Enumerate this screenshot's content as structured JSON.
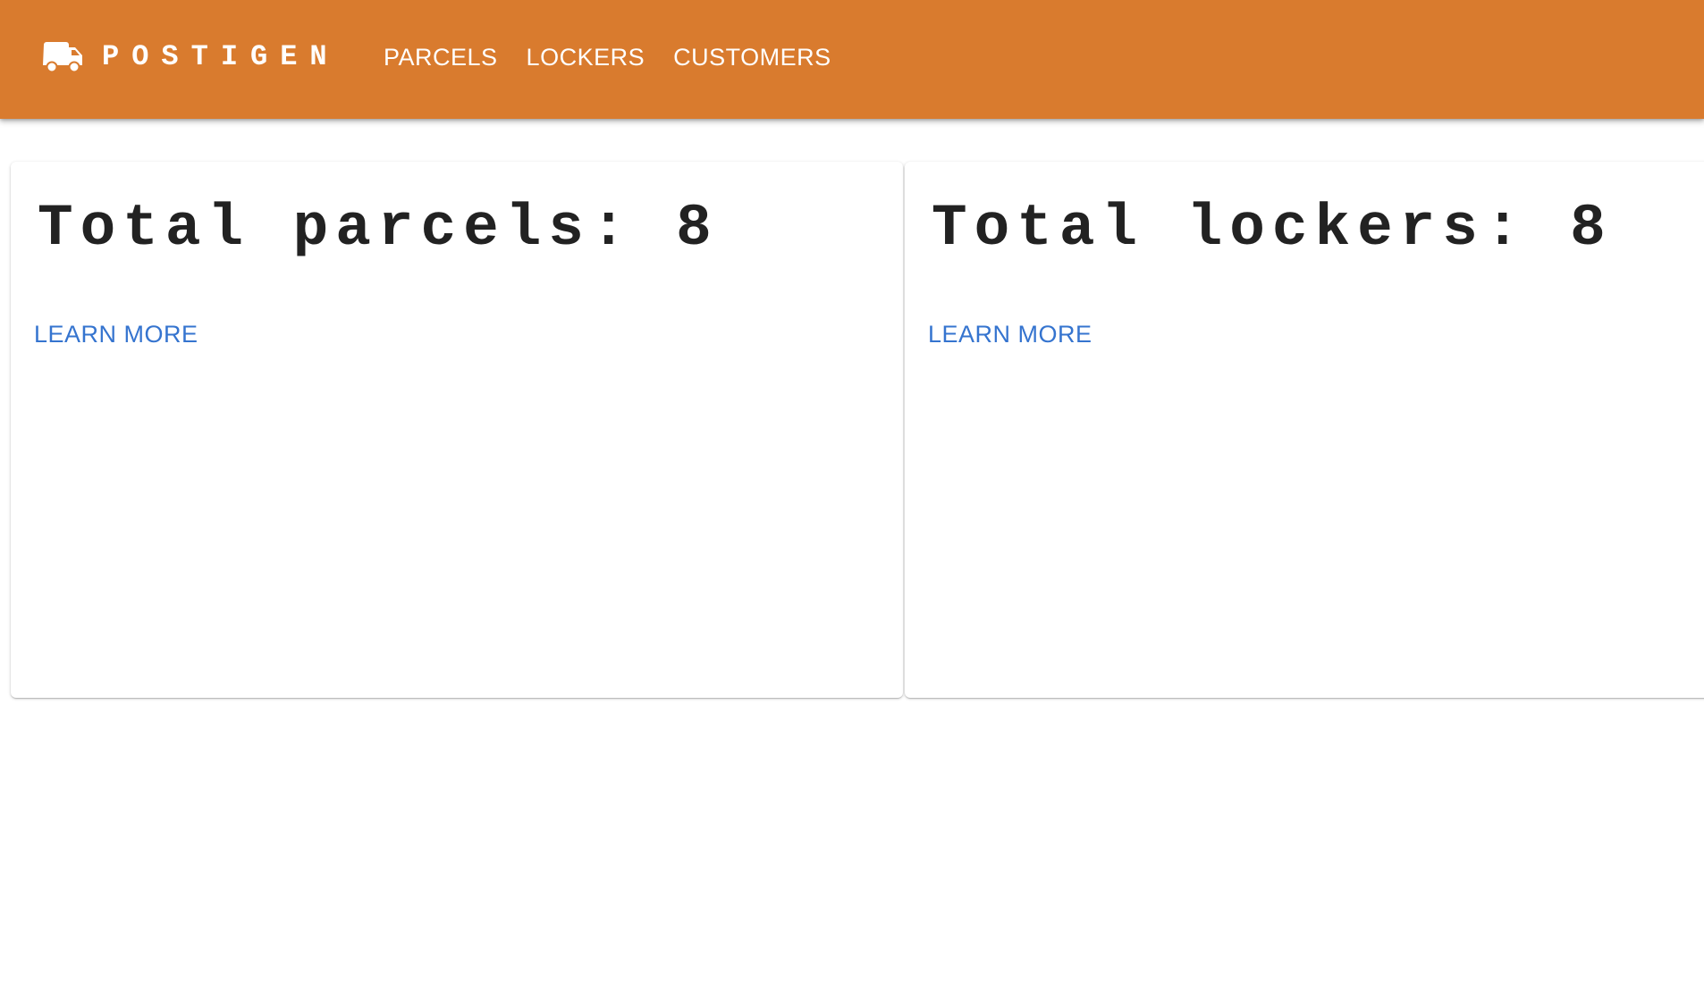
{
  "brand": {
    "icon": "truck-icon",
    "name": "POSTIGEN"
  },
  "nav": {
    "items": [
      {
        "label": "PARCELS"
      },
      {
        "label": "LOCKERS"
      },
      {
        "label": "CUSTOMERS"
      }
    ]
  },
  "cards": [
    {
      "title": "Total parcels: 8",
      "action": "LEARN MORE"
    },
    {
      "title": "Total lockers: 8",
      "action": "LEARN MORE"
    }
  ],
  "colors": {
    "appbar": "#D97B2E",
    "link": "#3574CF",
    "text": "#222222"
  }
}
